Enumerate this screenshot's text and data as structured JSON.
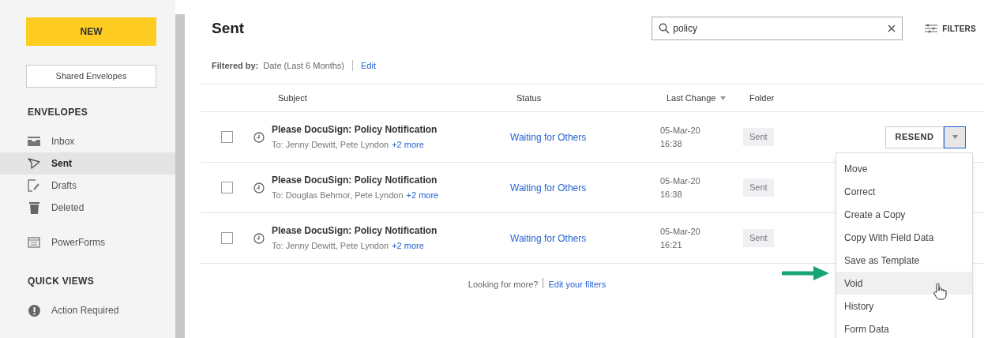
{
  "sidebar": {
    "new_button": "NEW",
    "shared_button": "Shared Envelopes",
    "sections": [
      {
        "heading": "ENVELOPES",
        "items": [
          {
            "label": "Inbox",
            "selected": false
          },
          {
            "label": "Sent",
            "selected": true
          },
          {
            "label": "Drafts",
            "selected": false
          },
          {
            "label": "Deleted",
            "selected": false
          },
          {
            "label": "PowerForms",
            "selected": false
          }
        ]
      },
      {
        "heading": "QUICK VIEWS",
        "items": [
          {
            "label": "Action Required",
            "selected": false
          }
        ]
      }
    ]
  },
  "header": {
    "title": "Sent",
    "search": {
      "value": "policy"
    },
    "filters_button": "FILTERS"
  },
  "filter_bar": {
    "label": "Filtered by:",
    "value": "Date (Last 6 Months)",
    "edit_link": "Edit"
  },
  "table": {
    "columns": [
      "Subject",
      "Status",
      "Last Change",
      "Folder"
    ],
    "rows": [
      {
        "checked": false,
        "subject": "Please DocuSign: Policy Notification",
        "recipients": "To: Jenny Dewitt, Pete Lyndon",
        "more": "+2 more",
        "status": "Waiting for Others",
        "date": "05-Mar-20",
        "time": "16:38",
        "folder": "Sent",
        "action_button": "RESEND"
      },
      {
        "checked": false,
        "subject": "Please DocuSign: Policy Notification",
        "recipients": "To: Douglas Behmor, Pete Lyndon",
        "more": "+2 more",
        "status": "Waiting for Others",
        "date": "05-Mar-20",
        "time": "16:38",
        "folder": "Sent"
      },
      {
        "checked": false,
        "subject": "Please DocuSign: Policy Notification",
        "recipients": "To: Jenny Dewitt, Pete Lyndon",
        "more": "+2 more",
        "status": "Waiting for Others",
        "date": "05-Mar-20",
        "time": "16:21",
        "folder": "Sent"
      }
    ],
    "footer": {
      "text": "Looking for more?",
      "link": "Edit your filters"
    }
  },
  "menu": {
    "items": [
      {
        "label": "Move",
        "selected": false
      },
      {
        "label": "Correct",
        "selected": false
      },
      {
        "label": "Create a Copy",
        "selected": false
      },
      {
        "label": "Copy With Field Data",
        "selected": false
      },
      {
        "label": "Save as Template",
        "selected": false
      },
      {
        "label": "Void",
        "selected": true
      },
      {
        "label": "History",
        "selected": false
      },
      {
        "label": "Form Data",
        "selected": false
      }
    ]
  }
}
